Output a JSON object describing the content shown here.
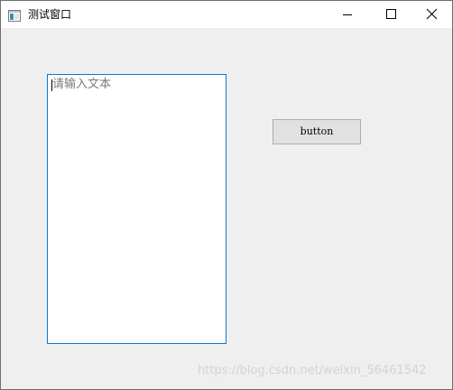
{
  "window": {
    "title": "测试窗口",
    "icon": "window-app-icon",
    "controls": {
      "minimize_icon": "minimize-icon",
      "maximize_icon": "maximize-icon",
      "close_icon": "close-icon"
    }
  },
  "text_edit": {
    "placeholder": "请输入文本",
    "value": "",
    "focused": true,
    "border_color": "#0a78d4"
  },
  "button": {
    "label": "button"
  },
  "watermark": {
    "text": "https://blog.csdn.net/weixin_56461542"
  }
}
